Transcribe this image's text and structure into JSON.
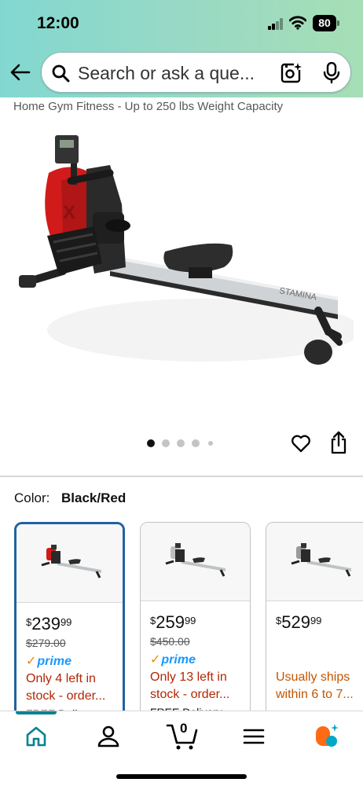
{
  "status_bar": {
    "time": "12:00",
    "battery": "80"
  },
  "search": {
    "placeholder": "Search or ask a que..."
  },
  "product": {
    "subtitle": "Home Gym Fitness - Up to 250 lbs Weight Capacity",
    "image_brand_text": "STAMINA",
    "image_count": 5,
    "current_image_index": 0
  },
  "color_selector": {
    "label": "Color:",
    "selected_value": "Black/Red",
    "options": [
      {
        "price_symbol": "$",
        "price_whole": "239",
        "price_fraction": "99",
        "list_price": "$279.00",
        "prime": "prime",
        "availability": "Only 4 left in stock - order...",
        "delivery": "FREE Delivery",
        "selected": true
      },
      {
        "price_symbol": "$",
        "price_whole": "259",
        "price_fraction": "99",
        "list_price": "$450.00",
        "prime": "prime",
        "availability": "Only 13 left in stock - order...",
        "delivery": "FREE Delivery",
        "selected": false
      },
      {
        "price_symbol": "$",
        "price_whole": "529",
        "price_fraction": "99",
        "list_price": "",
        "prime": "",
        "availability": "Usually ships within 6 to 7...",
        "delivery": "",
        "selected": false
      }
    ]
  },
  "tab_bar": {
    "cart_count": "0",
    "items": [
      "home-icon",
      "account-icon",
      "cart-icon",
      "menu-icon",
      "rufus-icon"
    ]
  },
  "colors": {
    "accent_teal": "#00838f",
    "selected_border": "#2162a1",
    "price_red": "#b12704",
    "ship_orange": "#c45500",
    "prime_blue": "#1a98ff"
  }
}
